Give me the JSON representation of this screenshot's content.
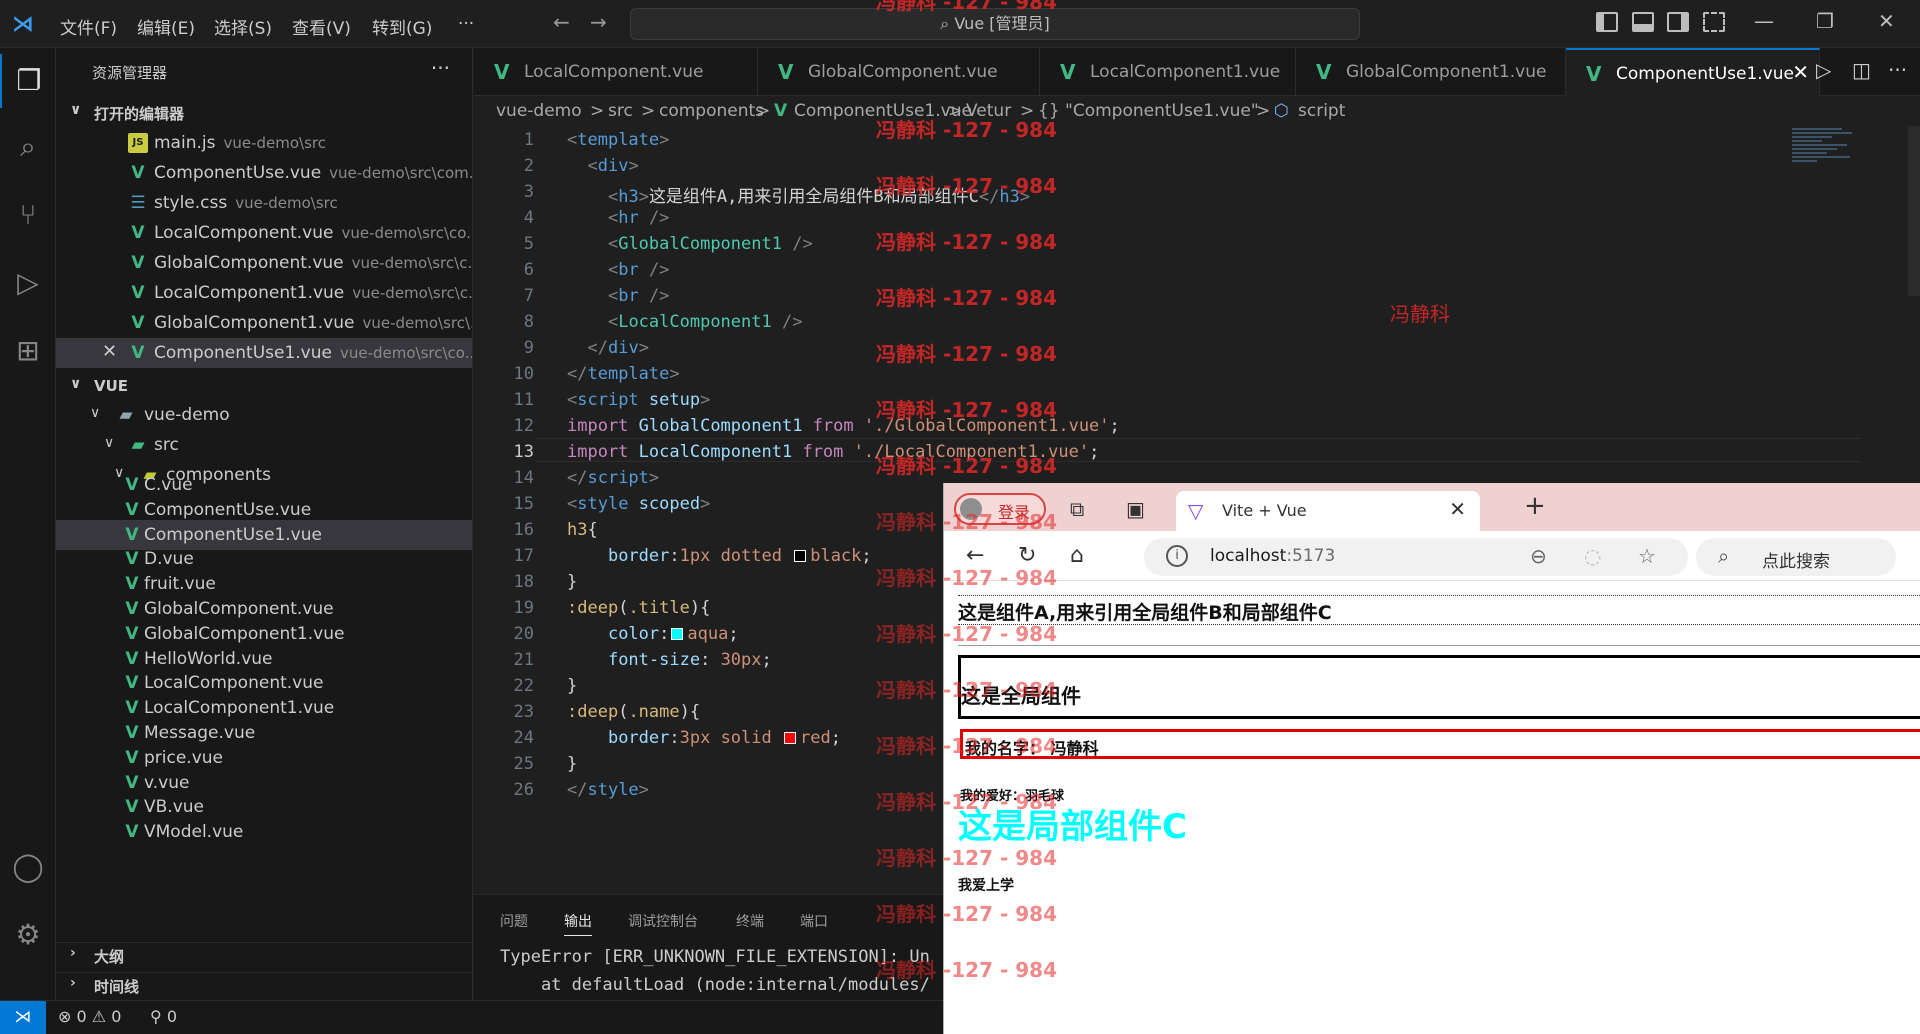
{
  "titlebar": {
    "menu": [
      "文件(F)",
      "编辑(E)",
      "选择(S)",
      "查看(V)",
      "转到(G)",
      "···"
    ],
    "command_center": "Vue [管理员]"
  },
  "sidebar": {
    "title": "资源管理器",
    "more": "···",
    "open_editors_label": "打开的编辑器",
    "open_editors": [
      {
        "icon": "js-icon",
        "glyph": "JS",
        "name": "main.js",
        "desc": "vue-demo\\src"
      },
      {
        "icon": "vue-icon",
        "glyph": "V",
        "name": "ComponentUse.vue",
        "desc": "vue-demo\\src\\com..."
      },
      {
        "icon": "css-icon",
        "glyph": "☰",
        "name": "style.css",
        "desc": "vue-demo\\src"
      },
      {
        "icon": "vue-icon",
        "glyph": "V",
        "name": "LocalComponent.vue",
        "desc": "vue-demo\\src\\co..."
      },
      {
        "icon": "vue-icon",
        "glyph": "V",
        "name": "GlobalComponent.vue",
        "desc": "vue-demo\\src\\c..."
      },
      {
        "icon": "vue-icon",
        "glyph": "V",
        "name": "LocalComponent1.vue",
        "desc": "vue-demo\\src\\c..."
      },
      {
        "icon": "vue-icon",
        "glyph": "V",
        "name": "GlobalComponent1.vue",
        "desc": "vue-demo\\src\\..."
      },
      {
        "icon": "vue-icon",
        "glyph": "V",
        "name": "ComponentUse1.vue",
        "desc": "vue-demo\\src\\co..."
      }
    ],
    "workspace_label": "VUE",
    "folders": [
      "vue-demo",
      "src",
      "components"
    ],
    "files": [
      "C.vue",
      "ComponentUse.vue",
      "ComponentUse1.vue",
      "D.vue",
      "fruit.vue",
      "GlobalComponent.vue",
      "GlobalComponent1.vue",
      "HelloWorld.vue",
      "LocalComponent.vue",
      "LocalComponent1.vue",
      "Message.vue",
      "price.vue",
      "v.vue",
      "VB.vue",
      "VModel.vue"
    ],
    "outline_label": "大纲",
    "timeline_label": "时间线"
  },
  "tabs": [
    "LocalComponent.vue",
    "GlobalComponent.vue",
    "LocalComponent1.vue",
    "GlobalComponent1.vue",
    "ComponentUse1.vue"
  ],
  "breadcrumbs": [
    "vue-demo",
    ">",
    "src",
    ">",
    "components",
    ">",
    "ComponentUse1.vue",
    ">",
    "Vetur",
    ">",
    "{} \"ComponentUse1.vue\"",
    ">",
    "script"
  ],
  "editor": {
    "line_numbers": [
      "1",
      "2",
      "3",
      "4",
      "5",
      "6",
      "7",
      "8",
      "9",
      "10",
      "11",
      "12",
      "13",
      "14",
      "15",
      "16",
      "17",
      "18",
      "19",
      "20",
      "21",
      "22",
      "23",
      "24",
      "25",
      "26"
    ],
    "current_line": "13"
  },
  "panel": {
    "tabs": [
      "问题",
      "输出",
      "调试控制台",
      "终端",
      "端口"
    ],
    "lines": [
      "TypeError [ERR_UNKNOWN_FILE_EXTENSION]: Un",
      "    at defaultLoad (node:internal/modules/"
    ]
  },
  "statusbar": {
    "errors": "0",
    "warnings": "0",
    "ports": "0"
  },
  "browser": {
    "login_label": "登录",
    "tab_title": "Vite + Vue",
    "url_host": "localhost",
    "url_port": ":5173",
    "search_placeholder": "点此搜索",
    "page": {
      "h3_a": "这是组件A,用来引用全局组件B和局部组件C",
      "h3_b": "这是全局组件",
      "name": "我的名字：  冯静科",
      "hobby": "我的爱好：羽毛球",
      "local": "这是局部组件C",
      "study": "我爱上学"
    }
  },
  "watermark": {
    "text": "冯静科 -127 - 984",
    "name": "冯静科"
  }
}
